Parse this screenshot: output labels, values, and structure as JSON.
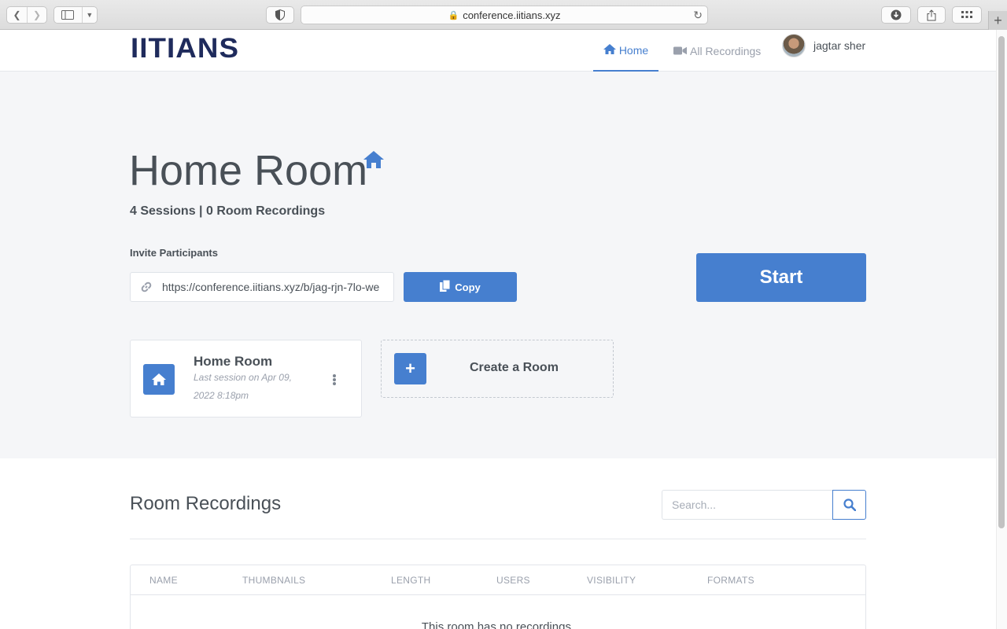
{
  "browser": {
    "url": "conference.iitians.xyz"
  },
  "header": {
    "logo": "IITIANS",
    "nav": {
      "home": "Home",
      "all_recordings": "All Recordings"
    },
    "user_name": "jagtar sher"
  },
  "room": {
    "title": "Home Room",
    "subtitle": "4 Sessions | 0 Room Recordings",
    "invite_label": "Invite Participants",
    "invite_url": "https://conference.iitians.xyz/b/jag-rjn-7lo-we",
    "copy_label": "Copy",
    "start_label": "Start"
  },
  "room_card": {
    "name": "Home Room",
    "last_session": "Last session on Apr 09, 2022 8:18pm"
  },
  "create_room": {
    "label": "Create a Room"
  },
  "recordings": {
    "title": "Room Recordings",
    "search_placeholder": "Search...",
    "columns": [
      "NAME",
      "THUMBNAILS",
      "LENGTH",
      "USERS",
      "VISIBILITY",
      "FORMATS"
    ],
    "empty_text": "This room has no recordings."
  },
  "colors": {
    "accent": "#467fcf",
    "logo": "#1f2b5c",
    "page_bg": "#f5f6f8"
  }
}
